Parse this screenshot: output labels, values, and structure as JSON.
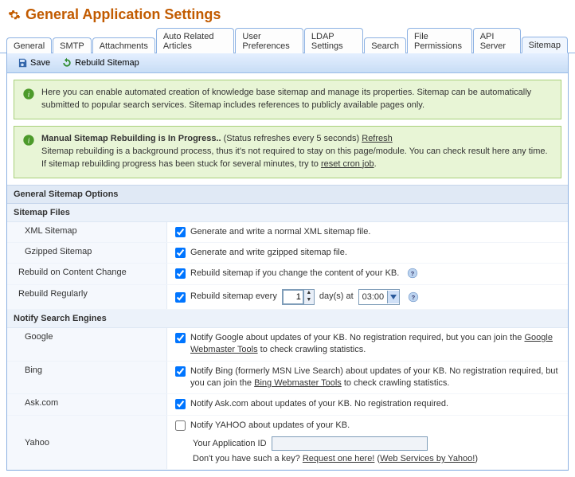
{
  "pageTitle": "General Application Settings",
  "tabs": [
    {
      "label": "General"
    },
    {
      "label": "SMTP"
    },
    {
      "label": "Attachments"
    },
    {
      "label": "Auto Related Articles"
    },
    {
      "label": "User Preferences"
    },
    {
      "label": "LDAP Settings"
    },
    {
      "label": "Search"
    },
    {
      "label": "File Permissions"
    },
    {
      "label": "API Server"
    },
    {
      "label": "Sitemap",
      "active": true
    }
  ],
  "toolbar": {
    "save": "Save",
    "rebuild": "Rebuild Sitemap"
  },
  "info1": "Here you can enable automated creation of knowledge base sitemap and manage its properties. Sitemap can be automatically submitted to popular search services. Sitemap includes references to publicly available pages only.",
  "info2": {
    "title": "Manual Sitemap Rebuilding is In Progress..",
    "refreshNote": "(Status refreshes every 5 seconds)",
    "refreshLink": "Refresh",
    "line2a": "Sitemap rebuilding is a background process, thus it's not required to stay on this page/module. You can check result here any time.",
    "line3a": "If sitemap rebuilding progress has been stuck for several minutes, try to ",
    "resetLink": "reset cron job",
    "line3b": "."
  },
  "sectionGeneral": "General Sitemap Options",
  "subSitemapFiles": "Sitemap Files",
  "rows": {
    "xml": {
      "label": "XML Sitemap",
      "desc": "Generate and write a normal XML sitemap file."
    },
    "gzip": {
      "label": "Gzipped Sitemap",
      "desc": "Generate and write gzipped sitemap file."
    },
    "change": {
      "label": "Rebuild on Content Change",
      "desc": "Rebuild sitemap if you change the content of your KB."
    },
    "reg": {
      "label": "Rebuild Regularly",
      "pre": "Rebuild sitemap every",
      "days": "1",
      "mid": "day(s) at",
      "time": "03:00"
    }
  },
  "subNotify": "Notify Search Engines",
  "notify": {
    "google": {
      "label": "Google",
      "pre": "Notify Google about updates of your KB. No registration required, but you can join the ",
      "link": "Google Webmaster Tools",
      "post": " to check crawling statistics."
    },
    "bing": {
      "label": "Bing",
      "pre": "Notify Bing (formerly MSN Live Search) about updates of your KB. No registration required, but you can join the ",
      "link": "Bing Webmaster Tools",
      "post": " to check crawling statistics."
    },
    "ask": {
      "label": "Ask.com",
      "desc": "Notify Ask.com about updates of your KB. No registration required."
    },
    "yahoo": {
      "label": "Yahoo",
      "desc": "Notify YAHOO about updates of your KB.",
      "appIdLabel": "Your Application ID",
      "notePre": "Don't you have such a key? ",
      "link1": "Request one here!",
      "noteSep": " (",
      "link2": "Web Services by Yahoo!",
      "noteEnd": ")"
    }
  }
}
